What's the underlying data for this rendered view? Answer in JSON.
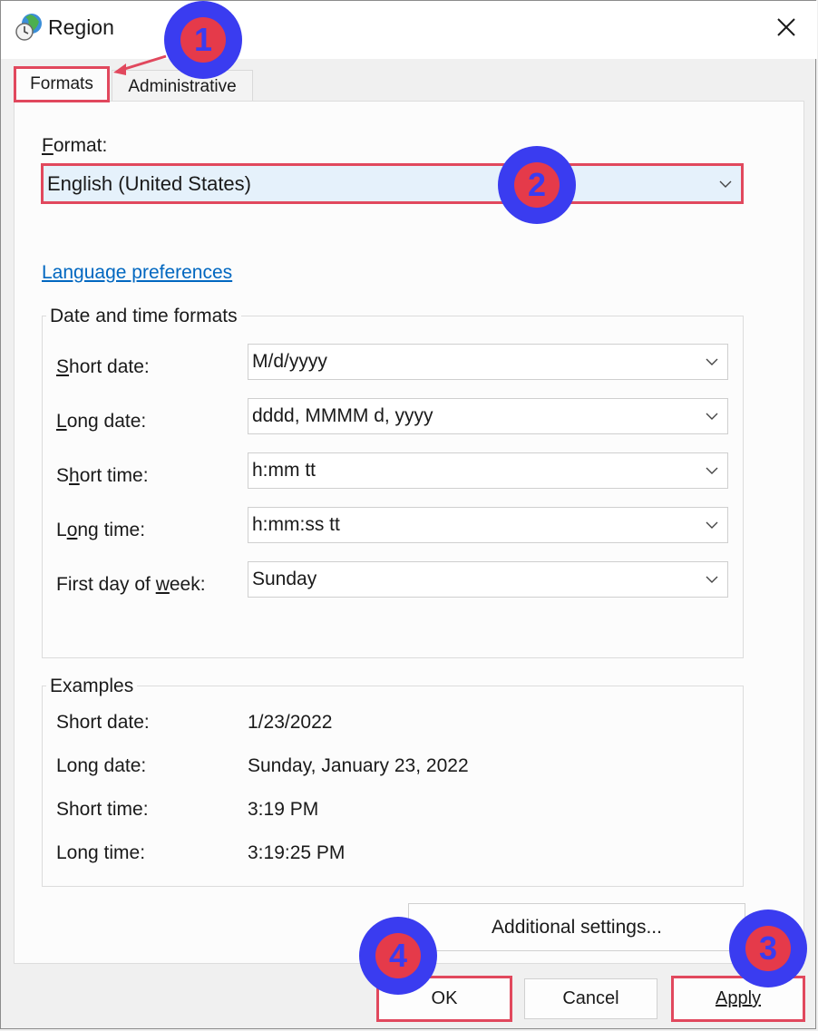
{
  "window": {
    "title": "Region"
  },
  "tabs": [
    {
      "label": "Formats",
      "selected": true
    },
    {
      "label": "Administrative",
      "selected": false
    }
  ],
  "format": {
    "label": "Format:",
    "value": "English (United States)"
  },
  "language_link": "Language preferences",
  "date_time_formats": {
    "title": "Date and time formats",
    "rows": [
      {
        "label": "Short date:",
        "value": "M/d/yyyy"
      },
      {
        "label": "Long date:",
        "value": "dddd, MMMM d, yyyy"
      },
      {
        "label": "Short time:",
        "value": "h:mm tt"
      },
      {
        "label": "Long time:",
        "value": "h:mm:ss tt"
      },
      {
        "label": "First day of week:",
        "value": "Sunday"
      }
    ]
  },
  "examples": {
    "title": "Examples",
    "rows": [
      {
        "label": "Short date:",
        "value": "1/23/2022"
      },
      {
        "label": "Long date:",
        "value": "Sunday, January 23, 2022"
      },
      {
        "label": "Short time:",
        "value": "3:19 PM"
      },
      {
        "label": "Long time:",
        "value": "3:19:25 PM"
      }
    ]
  },
  "buttons": {
    "additional": "Additional settings...",
    "ok": "OK",
    "cancel": "Cancel",
    "apply": "Apply"
  },
  "annotations": {
    "step1": "1",
    "step2": "2",
    "step3": "3",
    "step4": "4"
  },
  "colors": {
    "highlight_border": "#e1485d",
    "badge_fill": "#3a3cf0",
    "badge_number": "#e53a4a",
    "link": "#0067c0",
    "selected_combo": "#e5f1fb"
  }
}
